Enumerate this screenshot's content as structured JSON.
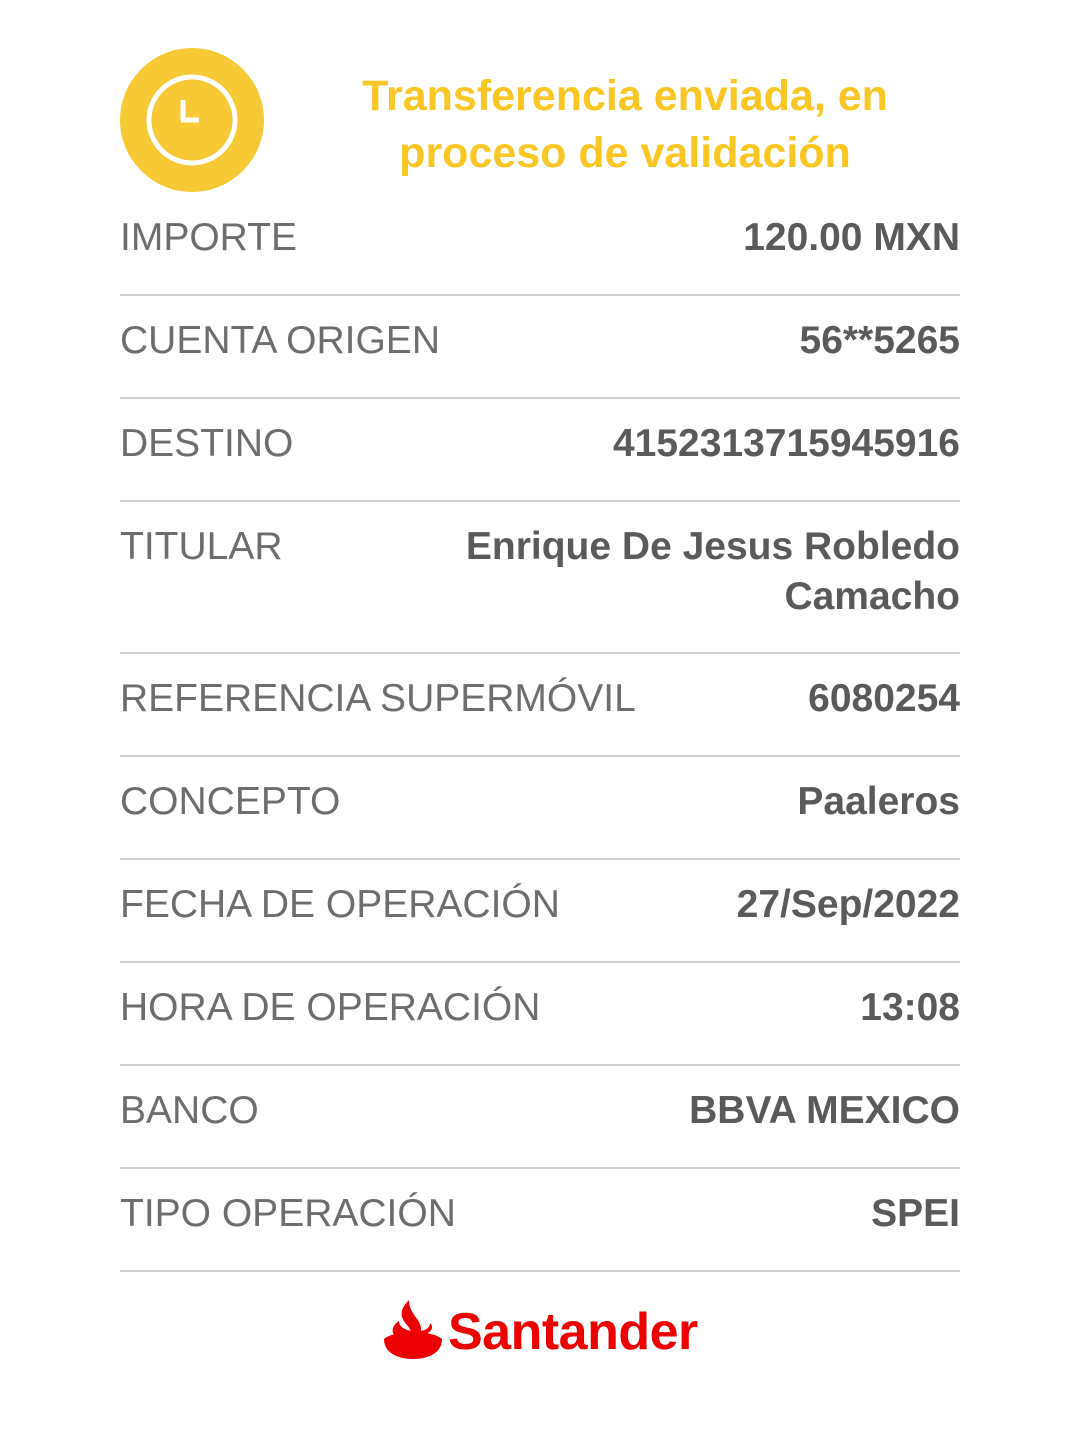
{
  "status": {
    "icon": "clock-icon",
    "title": "Transferencia enviada, en proceso de validación",
    "color": "#f7c934"
  },
  "details": [
    {
      "label": "IMPORTE",
      "value": "120.00 MXN"
    },
    {
      "label": "CUENTA ORIGEN",
      "value": "56**5265"
    },
    {
      "label": "DESTINO",
      "value": "4152313715945916"
    },
    {
      "label": "TITULAR",
      "value": "Enrique De Jesus Robledo Camacho"
    },
    {
      "label": "REFERENCIA SUPERMÓVIL",
      "value": "6080254"
    },
    {
      "label": "CONCEPTO",
      "value": "Paaleros"
    },
    {
      "label": "FECHA DE OPERACIÓN",
      "value": "27/Sep/2022"
    },
    {
      "label": "HORA DE OPERACIÓN",
      "value": "13:08"
    },
    {
      "label": "BANCO",
      "value": "BBVA MEXICO"
    },
    {
      "label": "TIPO OPERACIÓN",
      "value": "SPEI"
    }
  ],
  "brand": {
    "name": "Santander",
    "icon": "santander-flame-icon",
    "color": "#ec0000"
  }
}
